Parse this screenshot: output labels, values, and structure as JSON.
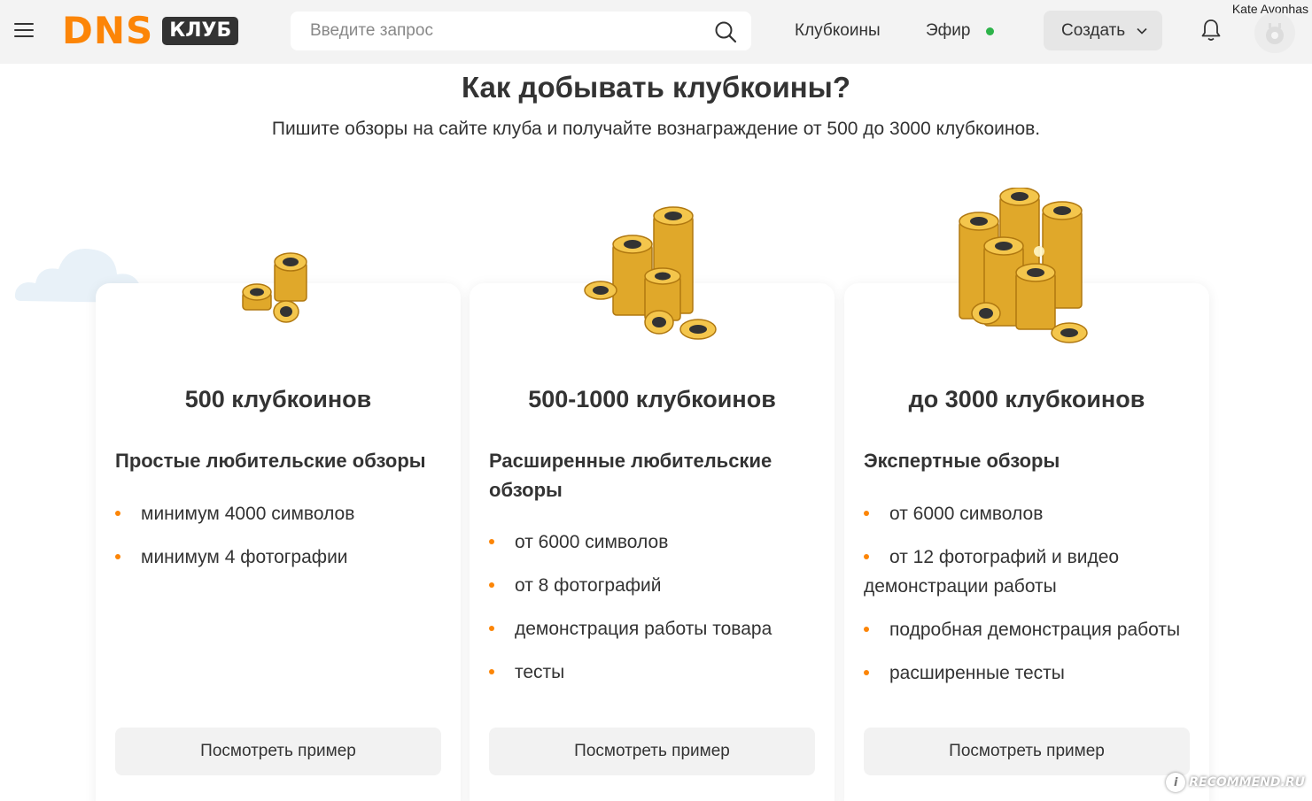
{
  "header": {
    "logo_main": "DNS",
    "logo_badge": "КЛУБ",
    "search_placeholder": "Введите запрос",
    "nav_clubcoins": "Клубкоины",
    "nav_live": "Эфир",
    "create_label": "Создать",
    "username": "Kate Avonhas",
    "icons": [
      "menu-icon",
      "search-icon",
      "live-status-dot",
      "chevron-down-icon",
      "bell-icon",
      "avatar"
    ],
    "live_color": "#2db34a",
    "brand_color": "#fc8507"
  },
  "main": {
    "title": "Как добывать клубкоины?",
    "subtitle": "Пишите обзоры на сайте клуба и получайте вознаграждение от 500 до 3000 клубкоинов."
  },
  "cards": [
    {
      "amount": "500 клубкоинов",
      "heading": "Простые любительские обзоры",
      "items": [
        "минимум 4000 символов",
        "минимум 4 фотографии"
      ],
      "button": "Посмотреть пример"
    },
    {
      "amount": "500-1000 клубкоинов",
      "heading": "Расширенные любительские обзоры",
      "items": [
        "от 6000 символов",
        "от 8 фотографий",
        "демонстрация работы товара",
        "тесты"
      ],
      "button": "Посмотреть пример"
    },
    {
      "amount": "до 3000 клубкоинов",
      "heading": "Экспертные обзоры",
      "items": [
        "от 6000 символов",
        "от 12 фотографий и видео демонстрации работы",
        "подробная демонстрация работы",
        "расширенные тесты"
      ],
      "button": "Посмотреть пример"
    }
  ],
  "watermark": "RECOMMEND.RU"
}
